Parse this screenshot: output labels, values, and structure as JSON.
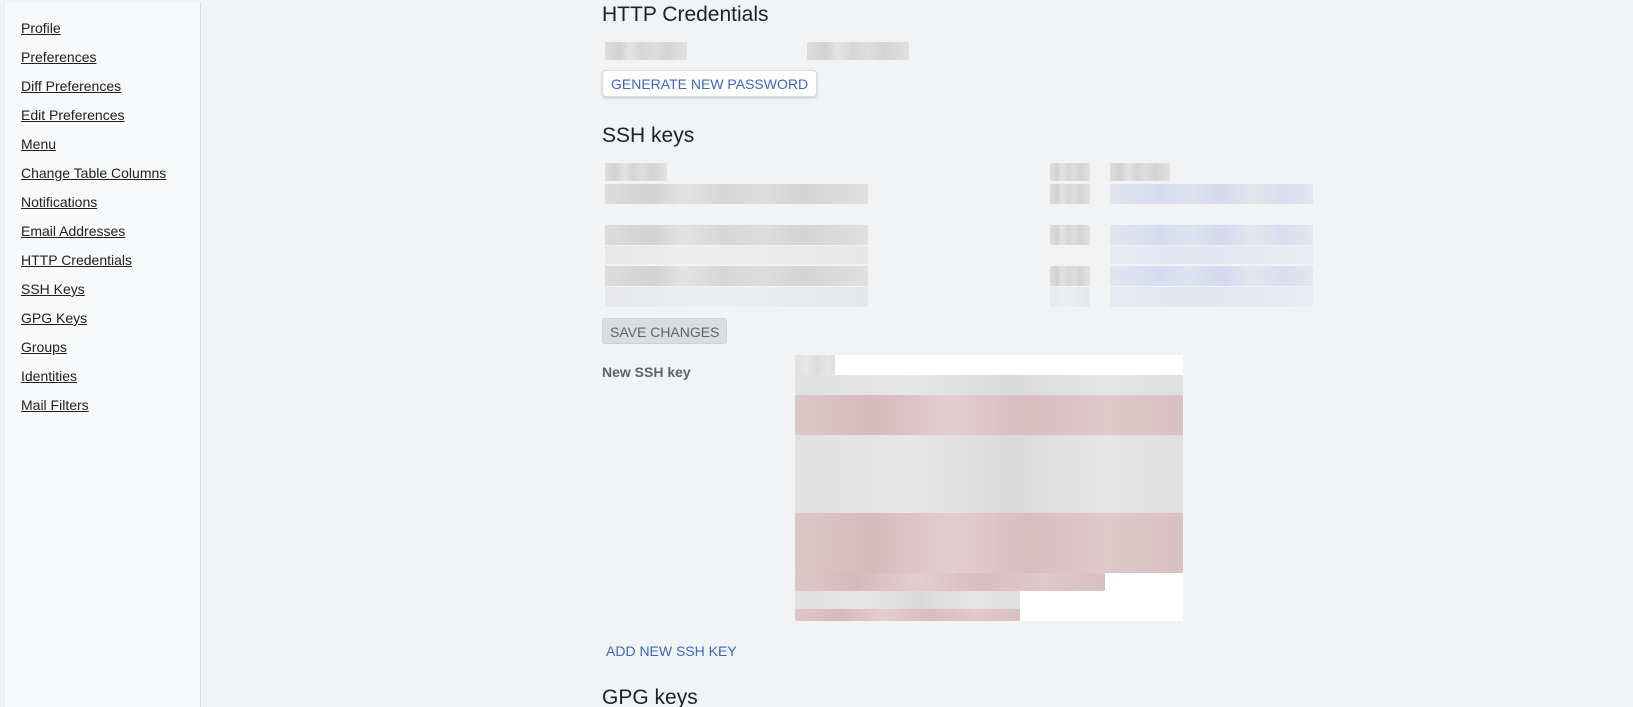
{
  "sidebar": {
    "items": [
      {
        "label": "Profile"
      },
      {
        "label": "Preferences"
      },
      {
        "label": "Diff Preferences"
      },
      {
        "label": "Edit Preferences"
      },
      {
        "label": "Menu"
      },
      {
        "label": "Change Table Columns"
      },
      {
        "label": "Notifications"
      },
      {
        "label": "Email Addresses"
      },
      {
        "label": "HTTP Credentials"
      },
      {
        "label": "SSH Keys"
      },
      {
        "label": "GPG Keys"
      },
      {
        "label": "Groups"
      },
      {
        "label": "Identities"
      },
      {
        "label": "Mail Filters"
      }
    ]
  },
  "http_credentials": {
    "title": "HTTP Credentials",
    "generate_button": "GENERATE NEW PASSWORD"
  },
  "ssh_keys": {
    "title": "SSH keys",
    "save_button": "SAVE CHANGES",
    "new_key_label": "New SSH key",
    "add_button": "ADD NEW SSH KEY"
  },
  "gpg_keys": {
    "title": "GPG keys"
  },
  "colors": {
    "link_blue": "#3b66c4",
    "background": "#f1f3f4",
    "sidebar_bg": "#f8f9fa"
  }
}
